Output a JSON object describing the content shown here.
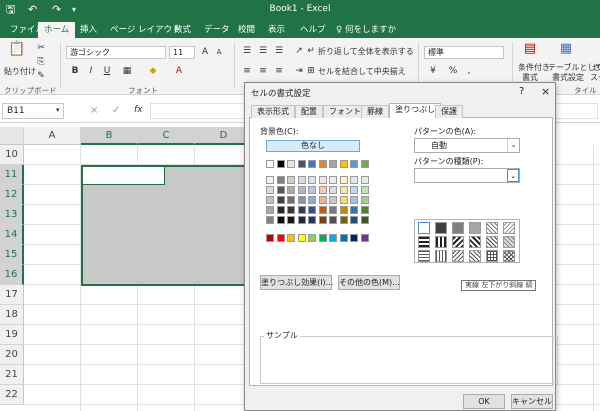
{
  "app": {
    "title": "Book1 - Excel",
    "accent": "#217346"
  },
  "quick_access": [
    "save-icon",
    "undo-icon",
    "redo-icon",
    "customize-icon"
  ],
  "tabs": [
    {
      "label": "ファイル"
    },
    {
      "label": "ホーム"
    },
    {
      "label": "挿入"
    },
    {
      "label": "ページ レイアウト"
    },
    {
      "label": "数式"
    },
    {
      "label": "データ"
    },
    {
      "label": "校閲"
    },
    {
      "label": "表示"
    },
    {
      "label": "ヘルプ"
    }
  ],
  "tell_me": "何をしますか",
  "ribbon": {
    "paste_label": "貼り付け",
    "clipboard_group": "クリップボード",
    "font_name": "游ゴシック",
    "font_size": "11",
    "font_group": "フォント",
    "bold": "B",
    "italic": "I",
    "underline": "U",
    "wrap_text": "折り返して全体を表示する",
    "merge_center": "セルを結合して中央揃え",
    "number_format": "標準",
    "percent": "%",
    "comma": ",",
    "cond_format_1": "条件付き",
    "cond_format_2": "書式",
    "table_format_1": "テーブルとして",
    "table_format_2": "書式設定",
    "cell_styles": "セ",
    "cell_styles_2": "スタ",
    "style_group": "タイル"
  },
  "formula_bar": {
    "name_box": "B11",
    "cancel": "×",
    "enter": "✓",
    "fx": "fx"
  },
  "columns": [
    "A",
    "B",
    "C",
    "D"
  ],
  "rows": [
    "10",
    "11",
    "12",
    "13",
    "14",
    "15",
    "16",
    "17",
    "18",
    "19",
    "20",
    "21",
    "22"
  ],
  "dialog": {
    "title": "セルの書式設定",
    "help": "?",
    "close": "×",
    "tabs": [
      "表示形式",
      "配置",
      "フォント",
      "罫線",
      "塗りつぶし",
      "保護"
    ],
    "active_tab": "塗りつぶし",
    "bg_color_label": "背景色(C):",
    "no_color": "色なし",
    "fill_effects": "塗りつぶし効果(I)...",
    "more_colors": "その他の色(M)...",
    "pattern_color_label": "パターンの色(A):",
    "pattern_color_value": "自動",
    "pattern_style_label": "パターンの種類(P):",
    "tooltip": "実線 左下がり斜線 縞",
    "sample_label": "サンプル",
    "ok": "OK",
    "cancel": "キャンセル",
    "theme_colors": [
      [
        "#ffffff",
        "#000000",
        "#e7e6e6",
        "#44546a",
        "#4472c4",
        "#ed7d31",
        "#a5a5a5",
        "#ffc000",
        "#5b9bd5",
        "#70ad47"
      ],
      [
        "#f2f2f2",
        "#808080",
        "#d0cece",
        "#d6dce4",
        "#d9e2f3",
        "#fbe5d5",
        "#ededed",
        "#fff2cc",
        "#deebf6",
        "#e2efd9"
      ],
      [
        "#d9d9d9",
        "#595959",
        "#aeaaaa",
        "#adb9ca",
        "#b4c6e7",
        "#f7cbac",
        "#dbdbdb",
        "#fee599",
        "#bdd7ee",
        "#c5e0b3"
      ],
      [
        "#bfbfbf",
        "#404040",
        "#757070",
        "#8496b0",
        "#8eaadb",
        "#f4b183",
        "#c9c9c9",
        "#ffd965",
        "#9cc3e5",
        "#a8d08d"
      ],
      [
        "#a6a6a6",
        "#262626",
        "#3a3838",
        "#323f4f",
        "#2f5496",
        "#c55a11",
        "#7b7b7b",
        "#bf8f00",
        "#2e75b5",
        "#538135"
      ],
      [
        "#808080",
        "#0d0d0d",
        "#171616",
        "#222a35",
        "#1f3864",
        "#833c0b",
        "#525252",
        "#7f6000",
        "#1e4e79",
        "#375623"
      ]
    ],
    "standard_colors": [
      "#c00000",
      "#ff0000",
      "#ffc000",
      "#ffff00",
      "#92d050",
      "#00b050",
      "#00b0f0",
      "#0070c0",
      "#002060",
      "#7030a0"
    ]
  }
}
